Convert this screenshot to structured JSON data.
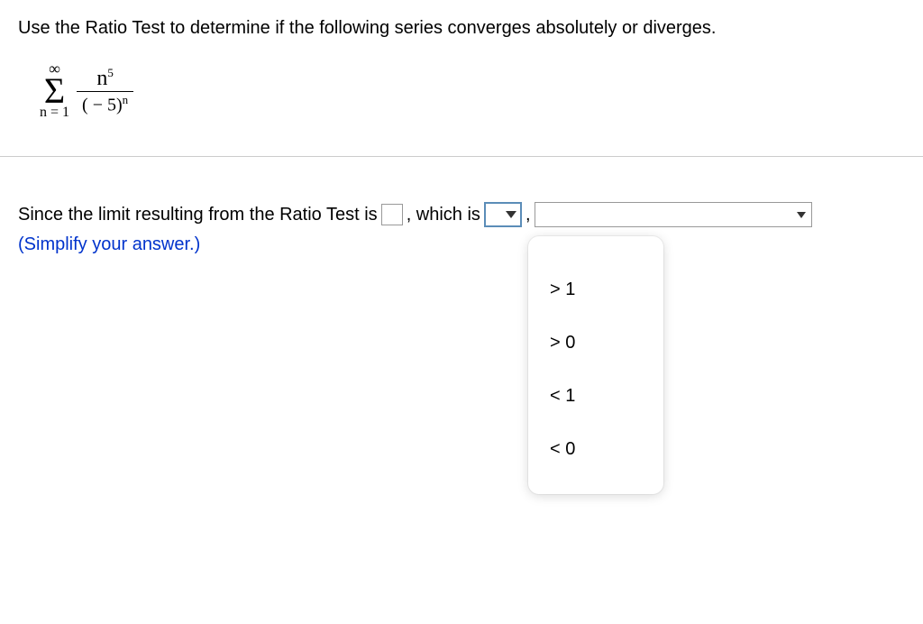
{
  "question": "Use the Ratio Test to determine if the following series converges absolutely or diverges.",
  "formula": {
    "sigma_top": "∞",
    "sigma_bottom": "n = 1",
    "numerator_base": "n",
    "numerator_exp": "5",
    "denominator_base": "( − 5)",
    "denominator_exp": "n"
  },
  "answer": {
    "prefix": "Since the limit resulting from the Ratio Test is",
    "mid": ", which is",
    "comma": ",",
    "hint": "(Simplify your answer.)"
  },
  "dropdown_options": [
    "> 1",
    "> 0",
    "< 1",
    "< 0"
  ]
}
